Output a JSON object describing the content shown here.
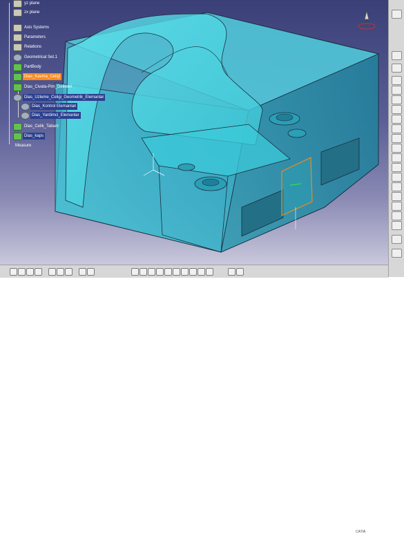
{
  "app": {
    "name": "CATIA"
  },
  "colors": {
    "background_top": "#3a3f78",
    "background_bottom": "#c9c8dc",
    "part_face": "#4fd5e0",
    "part_edge": "#1b2c3b",
    "highlight_orange": "#ff8a1c",
    "highlight_blue": "#2a3f8e"
  },
  "tree": {
    "items": [
      {
        "label": "yz plane",
        "icon": "plane-icon",
        "selected": false
      },
      {
        "label": "zx plane",
        "icon": "plane-icon",
        "selected": false
      },
      {
        "label": "Axis Systems",
        "icon": "axis-system-icon",
        "selected": false
      },
      {
        "label": "Parameters",
        "icon": "parameters-icon",
        "selected": false
      },
      {
        "label": "Relations",
        "icon": "relations-icon",
        "selected": false
      },
      {
        "label": "Geometrical Set.1",
        "icon": "geometrical-set-icon",
        "selected": false
      },
      {
        "label": "PartBody",
        "icon": "partbody-icon",
        "selected": false
      },
      {
        "label": "Dias_Kavma_Celigi",
        "icon": "body-icon",
        "selected": "orange"
      },
      {
        "label": "Dias_Civata-Pim_Delikleri",
        "icon": "body-icon",
        "selected": false
      },
      {
        "label": "Dias_Uzleme_Celigi_Geometrik_Elemanlar",
        "icon": "set-icon",
        "selected": "blue"
      },
      {
        "label": "Dias_Kontrol Elemanlari",
        "icon": "set-icon",
        "selected": "blue"
      },
      {
        "label": "Dias_Yardimci_Elemanlar",
        "icon": "set-icon",
        "selected": "blue"
      },
      {
        "label": "Dias_Celik_Tabani",
        "icon": "body-icon",
        "selected": false
      },
      {
        "label": "Dias_kaps",
        "icon": "body-icon",
        "selected": "blue"
      },
      {
        "label": "Measure",
        "icon": "measure-icon",
        "selected": false
      }
    ]
  },
  "toolbars": {
    "right": [
      "select-icon",
      "sketch-icon",
      "pad-icon",
      "pocket-icon",
      "shaft-icon",
      "hole-icon",
      "rib-icon",
      "slot-icon",
      "fillet-icon",
      "chamfer-icon",
      "draft-icon",
      "shell-icon",
      "thickness-icon",
      "thread-icon",
      "split-icon",
      "mirror-icon",
      "pattern-icon",
      "scale-icon",
      "boolean-icon",
      "measure-icon",
      "material-icon"
    ],
    "bottom": [
      "new-icon",
      "open-icon",
      "save-icon",
      "print-icon",
      "cut-icon",
      "copy-icon",
      "paste-icon",
      "undo-icon",
      "redo-icon",
      "fit-all-icon",
      "pan-icon",
      "rotate-icon",
      "zoom-in-icon",
      "zoom-out-icon",
      "normal-view-icon",
      "iso-view-icon",
      "shading-icon",
      "hide-show-icon",
      "swap-icon",
      "render-icon",
      "material-icon"
    ]
  }
}
